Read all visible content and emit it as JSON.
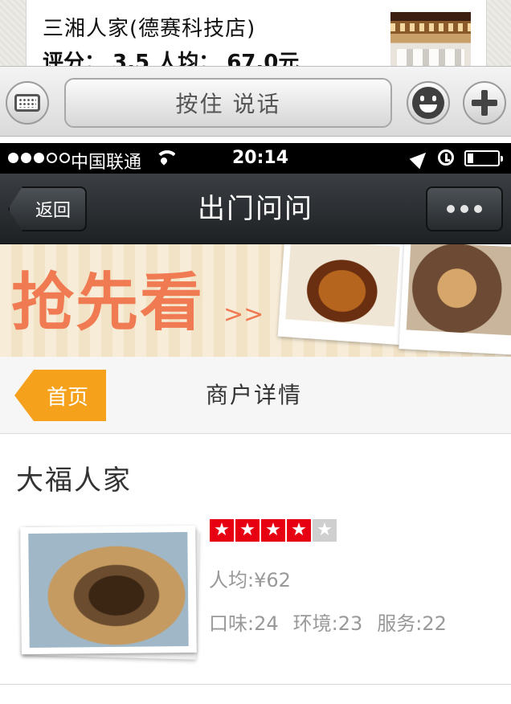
{
  "chat": {
    "card_title": "三湘人家(德赛科技店)",
    "card_sub": "评分： 3.5  人均： 67.0元"
  },
  "input_bar": {
    "hold_to_talk_label": "按住 说话"
  },
  "status_bar": {
    "carrier": "中国联通",
    "time": "20:14",
    "signal_bars_filled": 3,
    "signal_bars_total": 5,
    "battery_level": 0.2
  },
  "nav": {
    "back_label": "返回",
    "title": "出门问问"
  },
  "banner": {
    "text": "抢先看",
    "arrows": ">>"
  },
  "sub_nav": {
    "home_label": "首页",
    "detail_label": "商户详情"
  },
  "merchant": {
    "name": "大福人家",
    "rating": 4,
    "rating_max": 5,
    "avg_price": "人均:¥62",
    "taste": "口味:24",
    "environment": "环境:23",
    "service": "服务:22"
  },
  "colors": {
    "accent_orange": "#f5a11c",
    "star_red": "#e60012",
    "banner_text": "#f07a52"
  }
}
